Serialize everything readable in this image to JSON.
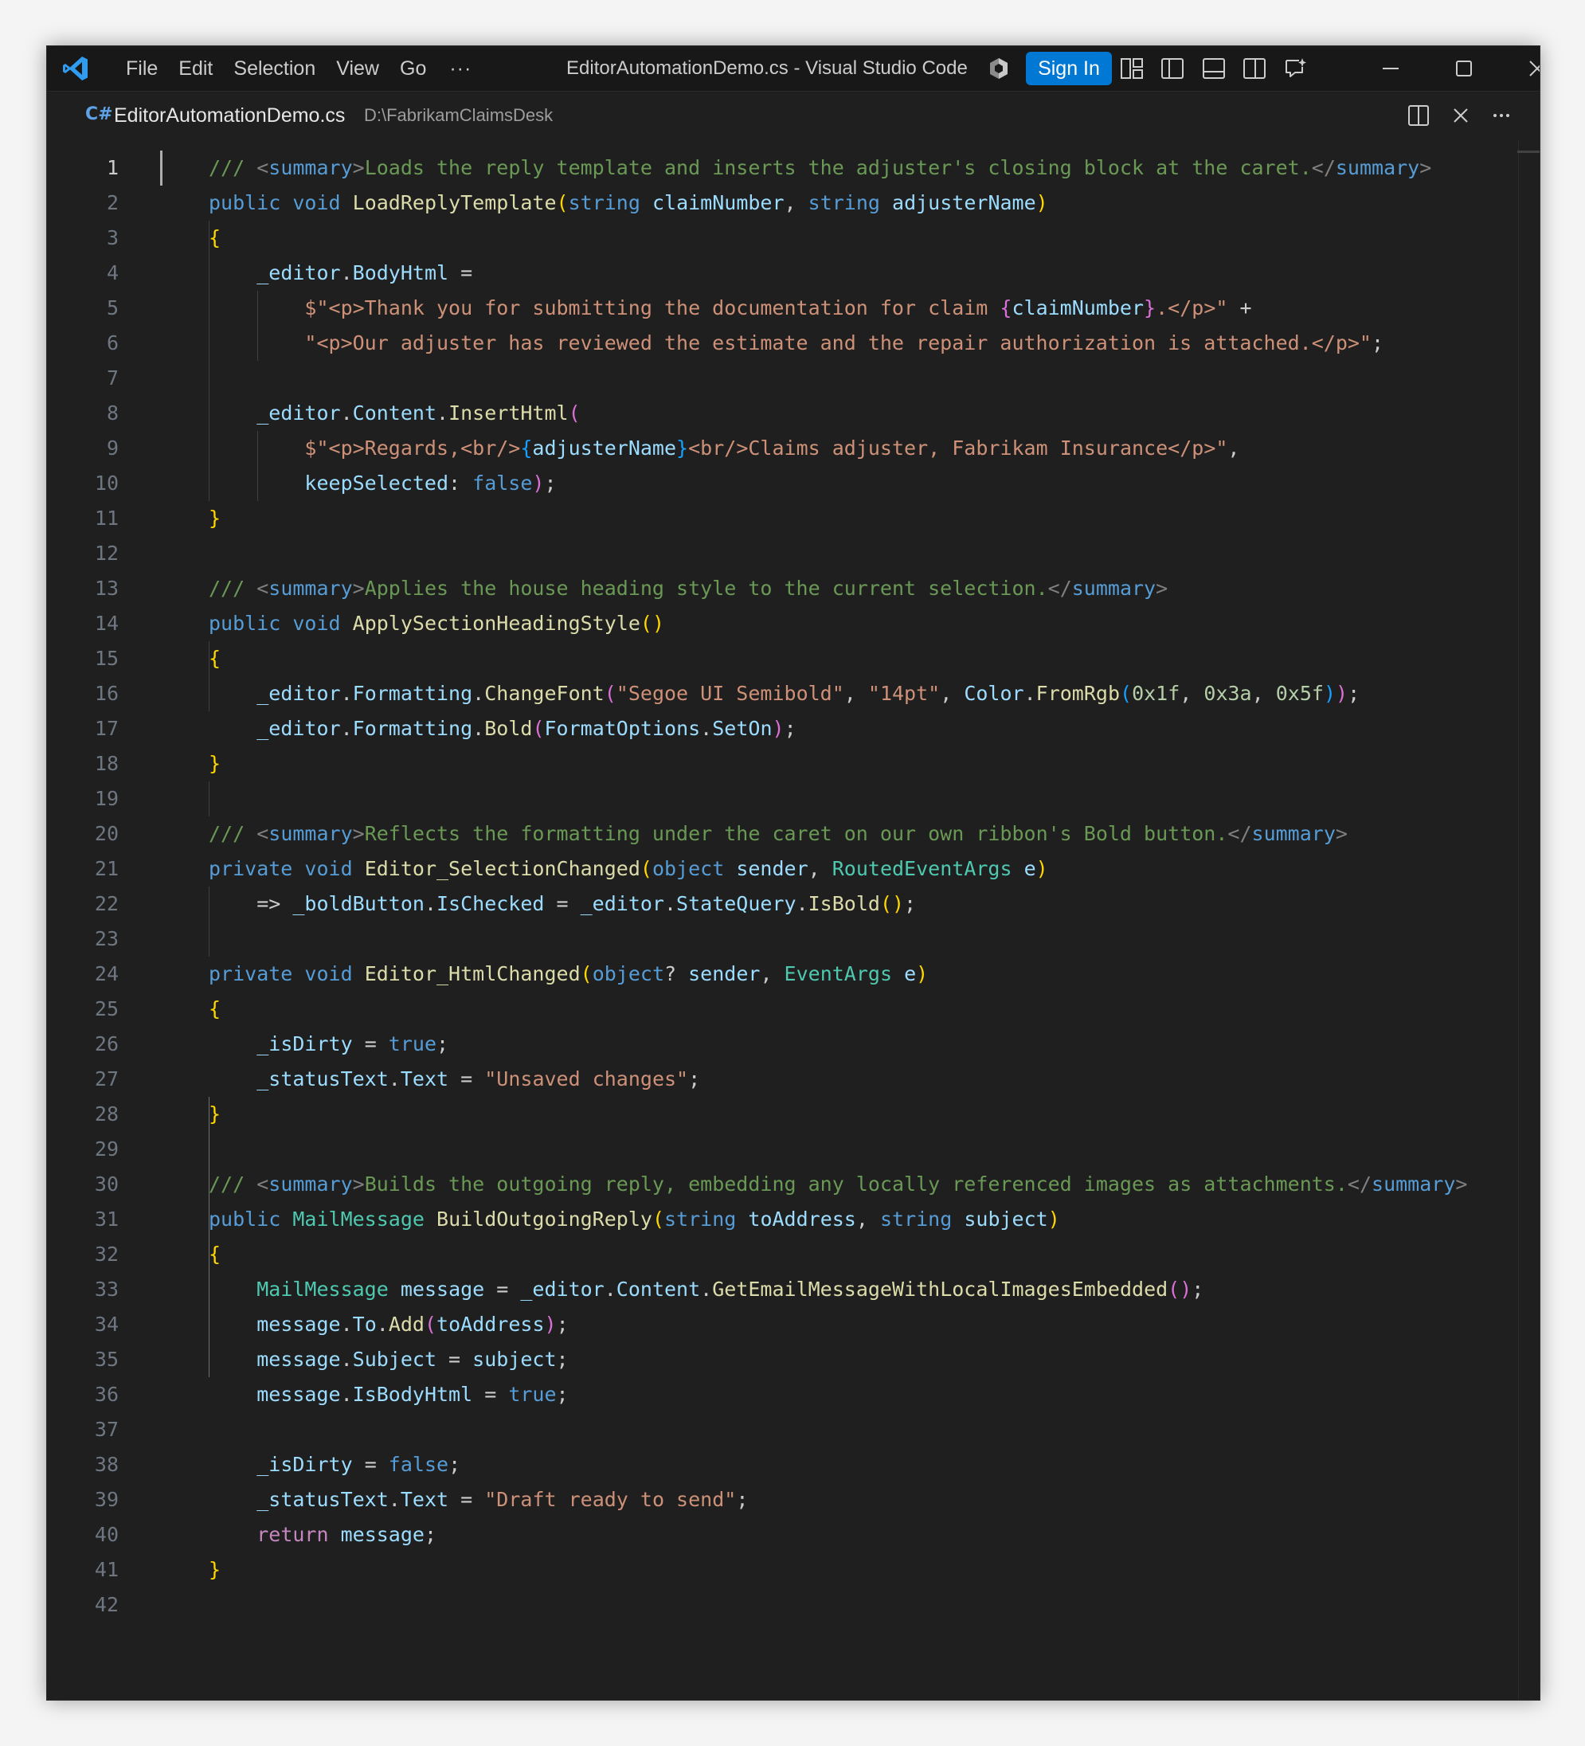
{
  "titlebar": {
    "menu": [
      "File",
      "Edit",
      "Selection",
      "View",
      "Go"
    ],
    "more": "···",
    "title": "EditorAutomationDemo.cs - Visual Studio Code",
    "sign_in": "Sign In"
  },
  "tab": {
    "lang_icon": "C#",
    "filename": "EditorAutomationDemo.cs",
    "path": "D:\\FabrikamClaimsDesk"
  },
  "colors": {
    "accent": "#0078d4",
    "editor_bg": "#1f1f1f",
    "titlebar_bg": "#181818",
    "comment": "#6a9955",
    "keyword": "#569cd6",
    "type": "#4ec9b0",
    "function": "#dcdcaa",
    "variable": "#9cdcfe",
    "string": "#ce9178",
    "number": "#b5cea8",
    "control": "#c586c0"
  },
  "icons": [
    "vscode-logo-icon",
    "copilot-icon",
    "customize-layout-icon",
    "toggle-primary-sidebar-icon",
    "toggle-panel-icon",
    "toggle-secondary-sidebar-icon",
    "chat-icon",
    "minimize-icon",
    "maximize-icon",
    "close-icon",
    "split-editor-icon",
    "close-tab-icon",
    "more-actions-icon"
  ],
  "editor": {
    "active_line": 1,
    "lines": [
      [
        [
          "cm",
          "/// "
        ],
        [
          "xd",
          "<"
        ],
        [
          "xt",
          "summary"
        ],
        [
          "xd",
          ">"
        ],
        [
          "cm",
          "Loads the reply template and inserts the adjuster's closing block at the caret."
        ],
        [
          "xd",
          "</"
        ],
        [
          "xt",
          "summary"
        ],
        [
          "xd",
          ">"
        ]
      ],
      [
        [
          "kw",
          "public"
        ],
        [
          "pn",
          " "
        ],
        [
          "kw",
          "void"
        ],
        [
          "pn",
          " "
        ],
        [
          "fn",
          "LoadReplyTemplate"
        ],
        [
          "b1",
          "("
        ],
        [
          "kw",
          "string"
        ],
        [
          "pn",
          " "
        ],
        [
          "vr",
          "claimNumber"
        ],
        [
          "pn",
          ", "
        ],
        [
          "kw",
          "string"
        ],
        [
          "pn",
          " "
        ],
        [
          "vr",
          "adjusterName"
        ],
        [
          "b1",
          ")"
        ]
      ],
      [
        [
          "b1",
          "{"
        ]
      ],
      [
        [
          "pn",
          "    "
        ],
        [
          "vr",
          "_editor"
        ],
        [
          "pn",
          "."
        ],
        [
          "vr",
          "BodyHtml"
        ],
        [
          "pn",
          " ="
        ]
      ],
      [
        [
          "pn",
          "        "
        ],
        [
          "st",
          "$\"<p>Thank you for submitting the documentation for claim "
        ],
        [
          "b2",
          "{"
        ],
        [
          "vr",
          "claimNumber"
        ],
        [
          "b2",
          "}"
        ],
        [
          "st",
          ".</p>\""
        ],
        [
          "pn",
          " +"
        ]
      ],
      [
        [
          "pn",
          "        "
        ],
        [
          "st",
          "\"<p>Our adjuster has reviewed the estimate and the repair authorization is attached.</p>\""
        ],
        [
          "pn",
          ";"
        ]
      ],
      [],
      [
        [
          "pn",
          "    "
        ],
        [
          "vr",
          "_editor"
        ],
        [
          "pn",
          "."
        ],
        [
          "vr",
          "Content"
        ],
        [
          "pn",
          "."
        ],
        [
          "fn",
          "InsertHtml"
        ],
        [
          "b2",
          "("
        ]
      ],
      [
        [
          "pn",
          "        "
        ],
        [
          "st",
          "$\"<p>Regards,<br/>"
        ],
        [
          "b3",
          "{"
        ],
        [
          "vr",
          "adjusterName"
        ],
        [
          "b3",
          "}"
        ],
        [
          "st",
          "<br/>Claims adjuster, Fabrikam Insurance</p>\""
        ],
        [
          "pn",
          ","
        ]
      ],
      [
        [
          "pn",
          "        "
        ],
        [
          "vr",
          "keepSelected"
        ],
        [
          "pn",
          ": "
        ],
        [
          "kw",
          "false"
        ],
        [
          "b2",
          ")"
        ],
        [
          "pn",
          ";"
        ]
      ],
      [
        [
          "b1",
          "}"
        ]
      ],
      [],
      [
        [
          "cm",
          "/// "
        ],
        [
          "xd",
          "<"
        ],
        [
          "xt",
          "summary"
        ],
        [
          "xd",
          ">"
        ],
        [
          "cm",
          "Applies the house heading style to the current selection."
        ],
        [
          "xd",
          "</"
        ],
        [
          "xt",
          "summary"
        ],
        [
          "xd",
          ">"
        ]
      ],
      [
        [
          "kw",
          "public"
        ],
        [
          "pn",
          " "
        ],
        [
          "kw",
          "void"
        ],
        [
          "pn",
          " "
        ],
        [
          "fn",
          "ApplySectionHeadingStyle"
        ],
        [
          "b1",
          "()"
        ]
      ],
      [
        [
          "b1",
          "{"
        ]
      ],
      [
        [
          "pn",
          "    "
        ],
        [
          "vr",
          "_editor"
        ],
        [
          "pn",
          "."
        ],
        [
          "vr",
          "Formatting"
        ],
        [
          "pn",
          "."
        ],
        [
          "fn",
          "ChangeFont"
        ],
        [
          "b2",
          "("
        ],
        [
          "st",
          "\"Segoe UI Semibold\""
        ],
        [
          "pn",
          ", "
        ],
        [
          "st",
          "\"14pt\""
        ],
        [
          "pn",
          ", "
        ],
        [
          "vr",
          "Color"
        ],
        [
          "pn",
          "."
        ],
        [
          "fn",
          "FromRgb"
        ],
        [
          "b3",
          "("
        ],
        [
          "nm",
          "0x1f"
        ],
        [
          "pn",
          ", "
        ],
        [
          "nm",
          "0x3a"
        ],
        [
          "pn",
          ", "
        ],
        [
          "nm",
          "0x5f"
        ],
        [
          "b3",
          ")"
        ],
        [
          "b2",
          ")"
        ],
        [
          "pn",
          ";"
        ]
      ],
      [
        [
          "pn",
          "    "
        ],
        [
          "vr",
          "_editor"
        ],
        [
          "pn",
          "."
        ],
        [
          "vr",
          "Formatting"
        ],
        [
          "pn",
          "."
        ],
        [
          "fn",
          "Bold"
        ],
        [
          "b2",
          "("
        ],
        [
          "vr",
          "FormatOptions"
        ],
        [
          "pn",
          "."
        ],
        [
          "vr",
          "SetOn"
        ],
        [
          "b2",
          ")"
        ],
        [
          "pn",
          ";"
        ]
      ],
      [
        [
          "b1",
          "}"
        ]
      ],
      [],
      [
        [
          "cm",
          "/// "
        ],
        [
          "xd",
          "<"
        ],
        [
          "xt",
          "summary"
        ],
        [
          "xd",
          ">"
        ],
        [
          "cm",
          "Reflects the formatting under the caret on our own ribbon's Bold button."
        ],
        [
          "xd",
          "</"
        ],
        [
          "xt",
          "summary"
        ],
        [
          "xd",
          ">"
        ]
      ],
      [
        [
          "kw",
          "private"
        ],
        [
          "pn",
          " "
        ],
        [
          "kw",
          "void"
        ],
        [
          "pn",
          " "
        ],
        [
          "fn",
          "Editor_SelectionChanged"
        ],
        [
          "b1",
          "("
        ],
        [
          "kw",
          "object"
        ],
        [
          "pn",
          " "
        ],
        [
          "vr",
          "sender"
        ],
        [
          "pn",
          ", "
        ],
        [
          "ty",
          "RoutedEventArgs"
        ],
        [
          "pn",
          " "
        ],
        [
          "vr",
          "e"
        ],
        [
          "b1",
          ")"
        ]
      ],
      [
        [
          "pn",
          "    => "
        ],
        [
          "vr",
          "_boldButton"
        ],
        [
          "pn",
          "."
        ],
        [
          "vr",
          "IsChecked"
        ],
        [
          "pn",
          " = "
        ],
        [
          "vr",
          "_editor"
        ],
        [
          "pn",
          "."
        ],
        [
          "vr",
          "StateQuery"
        ],
        [
          "pn",
          "."
        ],
        [
          "fn",
          "IsBold"
        ],
        [
          "b1",
          "()"
        ],
        [
          "pn",
          ";"
        ]
      ],
      [],
      [
        [
          "kw",
          "private"
        ],
        [
          "pn",
          " "
        ],
        [
          "kw",
          "void"
        ],
        [
          "pn",
          " "
        ],
        [
          "fn",
          "Editor_HtmlChanged"
        ],
        [
          "b1",
          "("
        ],
        [
          "kw",
          "object"
        ],
        [
          "pn",
          "? "
        ],
        [
          "vr",
          "sender"
        ],
        [
          "pn",
          ", "
        ],
        [
          "ty",
          "EventArgs"
        ],
        [
          "pn",
          " "
        ],
        [
          "vr",
          "e"
        ],
        [
          "b1",
          ")"
        ]
      ],
      [
        [
          "b1",
          "{"
        ]
      ],
      [
        [
          "pn",
          "    "
        ],
        [
          "vr",
          "_isDirty"
        ],
        [
          "pn",
          " = "
        ],
        [
          "kw",
          "true"
        ],
        [
          "pn",
          ";"
        ]
      ],
      [
        [
          "pn",
          "    "
        ],
        [
          "vr",
          "_statusText"
        ],
        [
          "pn",
          "."
        ],
        [
          "vr",
          "Text"
        ],
        [
          "pn",
          " = "
        ],
        [
          "st",
          "\"Unsaved changes\""
        ],
        [
          "pn",
          ";"
        ]
      ],
      [
        [
          "b1",
          "}"
        ]
      ],
      [],
      [
        [
          "cm",
          "/// "
        ],
        [
          "xd",
          "<"
        ],
        [
          "xt",
          "summary"
        ],
        [
          "xd",
          ">"
        ],
        [
          "cm",
          "Builds the outgoing reply, embedding any locally referenced images as attachments."
        ],
        [
          "xd",
          "</"
        ],
        [
          "xt",
          "summary"
        ],
        [
          "xd",
          ">"
        ]
      ],
      [
        [
          "kw",
          "public"
        ],
        [
          "pn",
          " "
        ],
        [
          "ty",
          "MailMessage"
        ],
        [
          "pn",
          " "
        ],
        [
          "fn",
          "BuildOutgoingReply"
        ],
        [
          "b1",
          "("
        ],
        [
          "kw",
          "string"
        ],
        [
          "pn",
          " "
        ],
        [
          "vr",
          "toAddress"
        ],
        [
          "pn",
          ", "
        ],
        [
          "kw",
          "string"
        ],
        [
          "pn",
          " "
        ],
        [
          "vr",
          "subject"
        ],
        [
          "b1",
          ")"
        ]
      ],
      [
        [
          "b1",
          "{"
        ]
      ],
      [
        [
          "pn",
          "    "
        ],
        [
          "ty",
          "MailMessage"
        ],
        [
          "pn",
          " "
        ],
        [
          "vr",
          "message"
        ],
        [
          "pn",
          " = "
        ],
        [
          "vr",
          "_editor"
        ],
        [
          "pn",
          "."
        ],
        [
          "vr",
          "Content"
        ],
        [
          "pn",
          "."
        ],
        [
          "fn",
          "GetEmailMessageWithLocalImagesEmbedded"
        ],
        [
          "b2",
          "()"
        ],
        [
          "pn",
          ";"
        ]
      ],
      [
        [
          "pn",
          "    "
        ],
        [
          "vr",
          "message"
        ],
        [
          "pn",
          "."
        ],
        [
          "vr",
          "To"
        ],
        [
          "pn",
          "."
        ],
        [
          "fn",
          "Add"
        ],
        [
          "b2",
          "("
        ],
        [
          "vr",
          "toAddress"
        ],
        [
          "b2",
          ")"
        ],
        [
          "pn",
          ";"
        ]
      ],
      [
        [
          "pn",
          "    "
        ],
        [
          "vr",
          "message"
        ],
        [
          "pn",
          "."
        ],
        [
          "vr",
          "Subject"
        ],
        [
          "pn",
          " = "
        ],
        [
          "vr",
          "subject"
        ],
        [
          "pn",
          ";"
        ]
      ],
      [
        [
          "pn",
          "    "
        ],
        [
          "vr",
          "message"
        ],
        [
          "pn",
          "."
        ],
        [
          "vr",
          "IsBodyHtml"
        ],
        [
          "pn",
          " = "
        ],
        [
          "kw",
          "true"
        ],
        [
          "pn",
          ";"
        ]
      ],
      [],
      [
        [
          "pn",
          "    "
        ],
        [
          "vr",
          "_isDirty"
        ],
        [
          "pn",
          " = "
        ],
        [
          "kw",
          "false"
        ],
        [
          "pn",
          ";"
        ]
      ],
      [
        [
          "pn",
          "    "
        ],
        [
          "vr",
          "_statusText"
        ],
        [
          "pn",
          "."
        ],
        [
          "vr",
          "Text"
        ],
        [
          "pn",
          " = "
        ],
        [
          "st",
          "\"Draft ready to send\""
        ],
        [
          "pn",
          ";"
        ]
      ],
      [
        [
          "pn",
          "    "
        ],
        [
          "ctl",
          "return"
        ],
        [
          "pn",
          " "
        ],
        [
          "vr",
          "message"
        ],
        [
          "pn",
          ";"
        ]
      ],
      [
        [
          "b1",
          "}"
        ]
      ],
      []
    ]
  }
}
